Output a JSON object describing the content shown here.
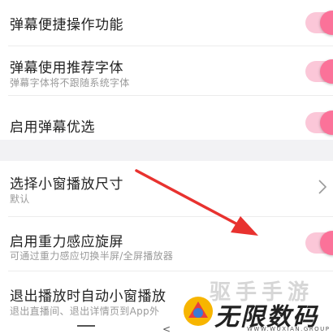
{
  "settings": {
    "group1": [
      {
        "title": "弹幕便捷操作功能",
        "subtitle": "",
        "toggle": "on"
      },
      {
        "title": "弹幕使用推荐字体",
        "subtitle": "弹幕字体将不跟随系统字体",
        "toggle": "on"
      },
      {
        "title": "启用弹幕优选",
        "subtitle": "",
        "toggle": "on"
      }
    ],
    "group2": [
      {
        "title": "选择小窗播放尺寸",
        "subtitle": "默认",
        "control": "chevron"
      },
      {
        "title": "启用重力感应旋屏",
        "subtitle": "可通过重力感应切换半屏/全屏播放器",
        "toggle": "on"
      },
      {
        "title": "退出播放时自动小窗播放",
        "subtitle": "退出直播间、退出详情页到App外"
      }
    ]
  },
  "colors": {
    "accent": "#fb7299",
    "track": "#fbc7d8",
    "arrow": "#e8322f",
    "section_gap": "#f2f2f4"
  },
  "watermark": {
    "top_text": "驱手手游",
    "main_text": "无限数码",
    "sub_text": "WWW.WUXIAN.GROUP"
  },
  "navbar": {
    "back_glyph": "<"
  }
}
